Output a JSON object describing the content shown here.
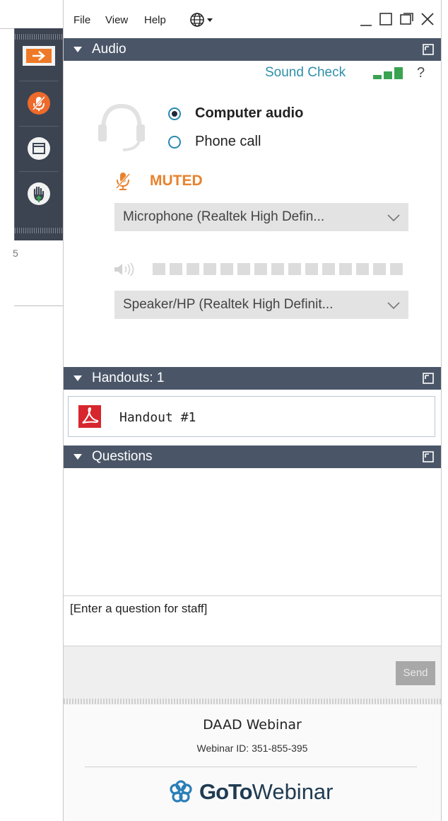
{
  "window": {
    "menu": [
      "File",
      "View",
      "Help"
    ],
    "language_icon": "globe-icon",
    "controls": [
      "minimize-icon",
      "maximize-icon",
      "popout-icon",
      "close-icon"
    ]
  },
  "left_toolbar": {
    "buttons": [
      "show-panel-arrow-icon",
      "microphone-muted-icon",
      "screen-viewer-icon",
      "raise-hand-icon"
    ],
    "background_text": "5"
  },
  "audio": {
    "section_title": "Audio",
    "sound_check_label": "Sound Check",
    "help_label": "?",
    "options": [
      {
        "label": "Computer audio",
        "selected": true
      },
      {
        "label": "Phone call",
        "selected": false
      }
    ],
    "mute_status": "MUTED",
    "microphone_device": "Microphone (Realtek High Defin...",
    "speaker_device": "Speaker/HP (Realtek High Definit...",
    "speaker_level": 0,
    "colors": {
      "accent": "#2f8fa9",
      "muted": "#e8822e",
      "signal": "#3aa351"
    }
  },
  "handouts": {
    "section_title": "Handouts: 1",
    "items": [
      {
        "label": "Handout #1",
        "icon": "pdf-icon"
      }
    ]
  },
  "questions": {
    "section_title": "Questions",
    "input_placeholder": "[Enter a question for staff]",
    "send_label": "Send"
  },
  "footer": {
    "webinar_title": "DAAD Webinar",
    "webinar_id": "Webinar ID: 351-855-395",
    "brand_bold": "GoTo",
    "brand_regular": "Webinar"
  }
}
